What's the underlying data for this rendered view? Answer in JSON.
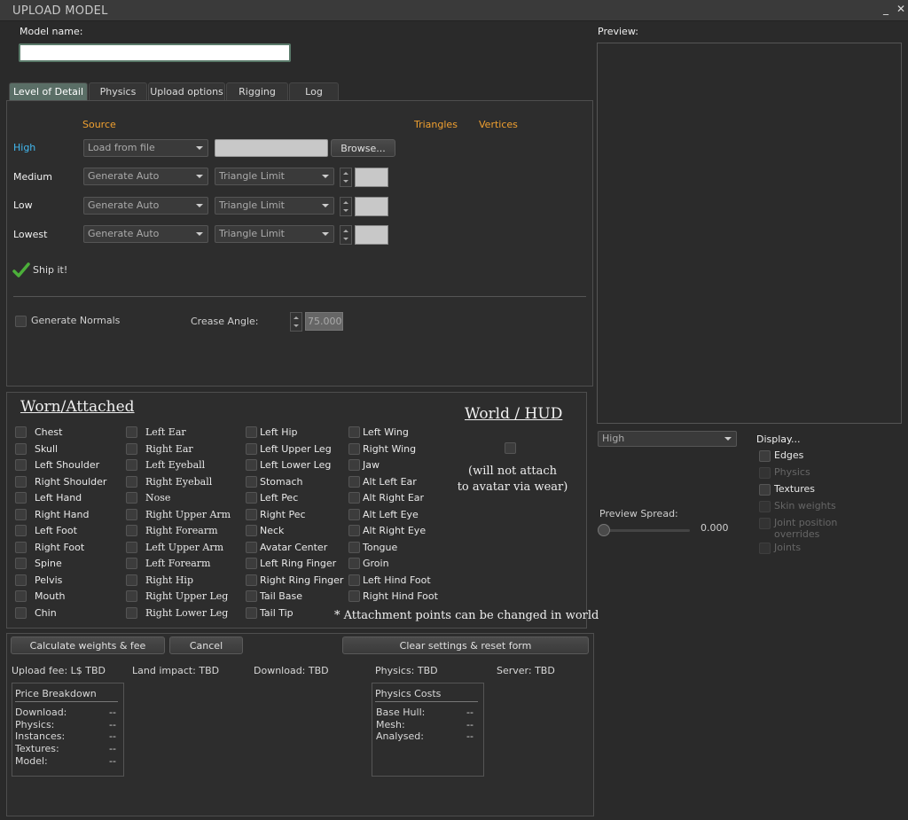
{
  "window": {
    "title": "UPLOAD MODEL",
    "minimize": "_",
    "close": "✕"
  },
  "model_name": {
    "label": "Model name:",
    "value": ""
  },
  "tabs": [
    {
      "label": "Level of Detail"
    },
    {
      "label": "Physics"
    },
    {
      "label": "Upload options"
    },
    {
      "label": "Rigging"
    },
    {
      "label": "Log"
    }
  ],
  "lod": {
    "headers": {
      "source": "Source",
      "triangles": "Triangles",
      "vertices": "Vertices"
    },
    "rows": [
      {
        "label": "High",
        "source": "Load from file",
        "browse": "Browse..."
      },
      {
        "label": "Medium",
        "source": "Generate Auto",
        "mode": "Triangle Limit"
      },
      {
        "label": "Low",
        "source": "Generate Auto",
        "mode": "Triangle Limit"
      },
      {
        "label": "Lowest",
        "source": "Generate Auto",
        "mode": "Triangle Limit"
      }
    ],
    "ship_it": "Ship it!",
    "generate_normals": "Generate Normals",
    "crease_angle_label": "Crease Angle:",
    "crease_angle_value": "75.000"
  },
  "worn": {
    "heading": "Worn/Attached",
    "col1": [
      "Chest",
      "Skull",
      "Left Shoulder",
      "Right Shoulder",
      "Left Hand",
      "Right Hand",
      "Left Foot",
      "Right Foot",
      "Spine",
      "Pelvis",
      "Mouth",
      "Chin"
    ],
    "col2": [
      "Left Ear",
      "Right Ear",
      "Left Eyeball",
      "Right Eyeball",
      "Nose",
      "Right Upper Arm",
      "Right Forearm",
      "Left Upper Arm",
      "Left Forearm",
      "Right Hip",
      "Right Upper Leg",
      "Right Lower Leg"
    ],
    "col3": [
      "Left Hip",
      "Left Upper Leg",
      "Left Lower Leg",
      "Stomach",
      "Left Pec",
      "Right Pec",
      "Neck",
      "Avatar Center",
      "Left Ring Finger",
      "Right Ring Finger",
      "Tail Base",
      "Tail Tip"
    ],
    "col4": [
      "Left  Wing",
      "Right  Wing",
      "Jaw",
      "Alt Left Ear",
      "Alt Right Ear",
      "Alt Left Eye",
      "Alt Right Eye",
      "Tongue",
      "Groin",
      "Left Hind Foot",
      "Right Hind Foot"
    ],
    "world_hud_heading": "World / HUD",
    "note_line1": "(will not attach",
    "note_line2": "to avatar via wear)",
    "footnote": "* Attachment points can be changed in world"
  },
  "actions": {
    "calculate": "Calculate weights & fee",
    "cancel": "Cancel",
    "clear": "Clear settings & reset form"
  },
  "stats": {
    "upload_fee": "Upload fee: L$ TBD",
    "land_impact": "Land impact: TBD",
    "download": "Download: TBD",
    "physics": "Physics: TBD",
    "server": "Server: TBD"
  },
  "price_breakdown": {
    "title": "Price Breakdown",
    "rows": [
      {
        "label": "Download:",
        "value": "--"
      },
      {
        "label": "Physics:",
        "value": "--"
      },
      {
        "label": "Instances:",
        "value": "--"
      },
      {
        "label": "Textures:",
        "value": "--"
      },
      {
        "label": "Model:",
        "value": "--"
      }
    ]
  },
  "physics_costs": {
    "title": "Physics Costs",
    "rows": [
      {
        "label": "Base Hull:",
        "value": "--"
      },
      {
        "label": "Mesh:",
        "value": "--"
      },
      {
        "label": "Analysed:",
        "value": "--"
      }
    ]
  },
  "preview": {
    "label": "Preview:",
    "lod_select": "High",
    "display_label": "Display...",
    "display_options": [
      {
        "label": "Edges",
        "enabled": true
      },
      {
        "label": "Physics",
        "enabled": false
      },
      {
        "label": "Textures",
        "enabled": true
      },
      {
        "label": "Skin weights",
        "enabled": false
      },
      {
        "label": "Joint position",
        "enabled": false
      },
      {
        "label": "overrides",
        "enabled": false
      },
      {
        "label": "Joints",
        "enabled": false
      }
    ],
    "spread_label": "Preview Spread:",
    "spread_value": "0.000"
  },
  "colors": {
    "accent_orange": "#f0a030",
    "accent_blue": "#42b8ef",
    "active_tab": "#5a6e66",
    "check_green": "#4caf3a"
  }
}
